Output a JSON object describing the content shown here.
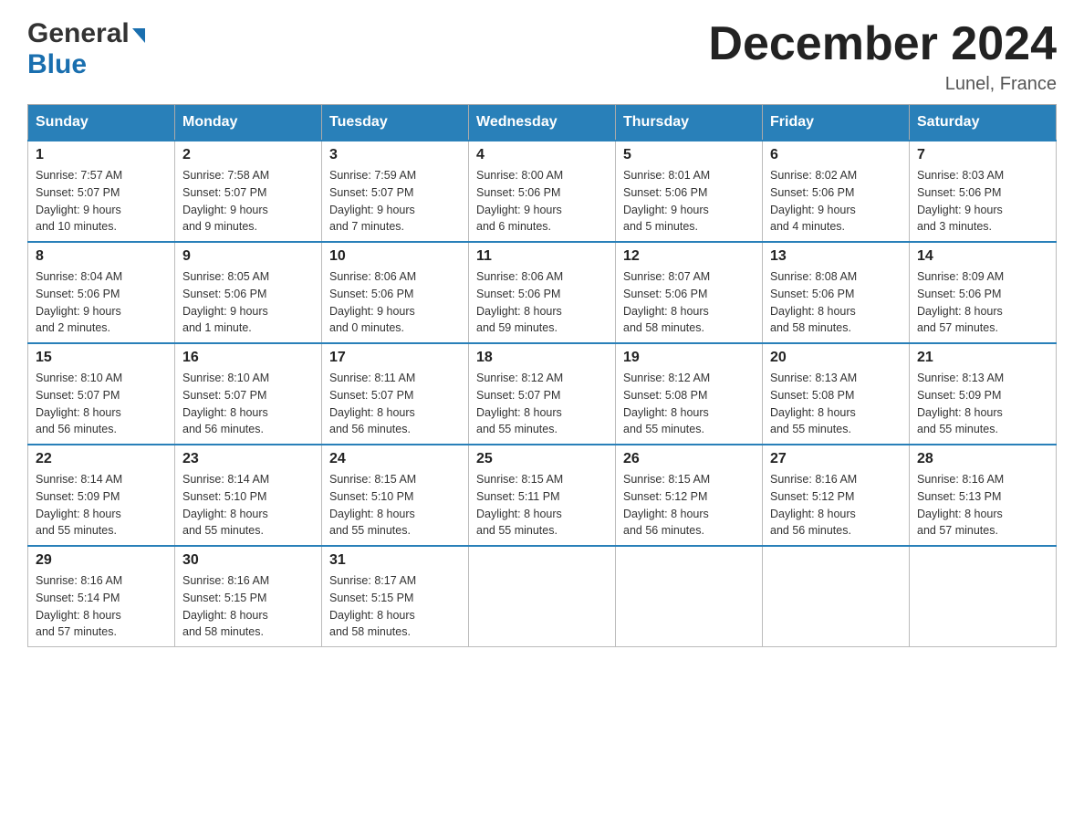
{
  "header": {
    "logo_general": "General",
    "logo_blue": "Blue",
    "month_title": "December 2024",
    "location": "Lunel, France"
  },
  "days_of_week": [
    "Sunday",
    "Monday",
    "Tuesday",
    "Wednesday",
    "Thursday",
    "Friday",
    "Saturday"
  ],
  "weeks": [
    [
      {
        "day": "1",
        "sunrise": "7:57 AM",
        "sunset": "5:07 PM",
        "daylight": "9 hours and 10 minutes."
      },
      {
        "day": "2",
        "sunrise": "7:58 AM",
        "sunset": "5:07 PM",
        "daylight": "9 hours and 9 minutes."
      },
      {
        "day": "3",
        "sunrise": "7:59 AM",
        "sunset": "5:07 PM",
        "daylight": "9 hours and 7 minutes."
      },
      {
        "day": "4",
        "sunrise": "8:00 AM",
        "sunset": "5:06 PM",
        "daylight": "9 hours and 6 minutes."
      },
      {
        "day": "5",
        "sunrise": "8:01 AM",
        "sunset": "5:06 PM",
        "daylight": "9 hours and 5 minutes."
      },
      {
        "day": "6",
        "sunrise": "8:02 AM",
        "sunset": "5:06 PM",
        "daylight": "9 hours and 4 minutes."
      },
      {
        "day": "7",
        "sunrise": "8:03 AM",
        "sunset": "5:06 PM",
        "daylight": "9 hours and 3 minutes."
      }
    ],
    [
      {
        "day": "8",
        "sunrise": "8:04 AM",
        "sunset": "5:06 PM",
        "daylight": "9 hours and 2 minutes."
      },
      {
        "day": "9",
        "sunrise": "8:05 AM",
        "sunset": "5:06 PM",
        "daylight": "9 hours and 1 minute."
      },
      {
        "day": "10",
        "sunrise": "8:06 AM",
        "sunset": "5:06 PM",
        "daylight": "9 hours and 0 minutes."
      },
      {
        "day": "11",
        "sunrise": "8:06 AM",
        "sunset": "5:06 PM",
        "daylight": "8 hours and 59 minutes."
      },
      {
        "day": "12",
        "sunrise": "8:07 AM",
        "sunset": "5:06 PM",
        "daylight": "8 hours and 58 minutes."
      },
      {
        "day": "13",
        "sunrise": "8:08 AM",
        "sunset": "5:06 PM",
        "daylight": "8 hours and 58 minutes."
      },
      {
        "day": "14",
        "sunrise": "8:09 AM",
        "sunset": "5:06 PM",
        "daylight": "8 hours and 57 minutes."
      }
    ],
    [
      {
        "day": "15",
        "sunrise": "8:10 AM",
        "sunset": "5:07 PM",
        "daylight": "8 hours and 56 minutes."
      },
      {
        "day": "16",
        "sunrise": "8:10 AM",
        "sunset": "5:07 PM",
        "daylight": "8 hours and 56 minutes."
      },
      {
        "day": "17",
        "sunrise": "8:11 AM",
        "sunset": "5:07 PM",
        "daylight": "8 hours and 56 minutes."
      },
      {
        "day": "18",
        "sunrise": "8:12 AM",
        "sunset": "5:07 PM",
        "daylight": "8 hours and 55 minutes."
      },
      {
        "day": "19",
        "sunrise": "8:12 AM",
        "sunset": "5:08 PM",
        "daylight": "8 hours and 55 minutes."
      },
      {
        "day": "20",
        "sunrise": "8:13 AM",
        "sunset": "5:08 PM",
        "daylight": "8 hours and 55 minutes."
      },
      {
        "day": "21",
        "sunrise": "8:13 AM",
        "sunset": "5:09 PM",
        "daylight": "8 hours and 55 minutes."
      }
    ],
    [
      {
        "day": "22",
        "sunrise": "8:14 AM",
        "sunset": "5:09 PM",
        "daylight": "8 hours and 55 minutes."
      },
      {
        "day": "23",
        "sunrise": "8:14 AM",
        "sunset": "5:10 PM",
        "daylight": "8 hours and 55 minutes."
      },
      {
        "day": "24",
        "sunrise": "8:15 AM",
        "sunset": "5:10 PM",
        "daylight": "8 hours and 55 minutes."
      },
      {
        "day": "25",
        "sunrise": "8:15 AM",
        "sunset": "5:11 PM",
        "daylight": "8 hours and 55 minutes."
      },
      {
        "day": "26",
        "sunrise": "8:15 AM",
        "sunset": "5:12 PM",
        "daylight": "8 hours and 56 minutes."
      },
      {
        "day": "27",
        "sunrise": "8:16 AM",
        "sunset": "5:12 PM",
        "daylight": "8 hours and 56 minutes."
      },
      {
        "day": "28",
        "sunrise": "8:16 AM",
        "sunset": "5:13 PM",
        "daylight": "8 hours and 57 minutes."
      }
    ],
    [
      {
        "day": "29",
        "sunrise": "8:16 AM",
        "sunset": "5:14 PM",
        "daylight": "8 hours and 57 minutes."
      },
      {
        "day": "30",
        "sunrise": "8:16 AM",
        "sunset": "5:15 PM",
        "daylight": "8 hours and 58 minutes."
      },
      {
        "day": "31",
        "sunrise": "8:17 AM",
        "sunset": "5:15 PM",
        "daylight": "8 hours and 58 minutes."
      },
      null,
      null,
      null,
      null
    ]
  ],
  "labels": {
    "sunrise": "Sunrise:",
    "sunset": "Sunset:",
    "daylight": "Daylight:"
  }
}
